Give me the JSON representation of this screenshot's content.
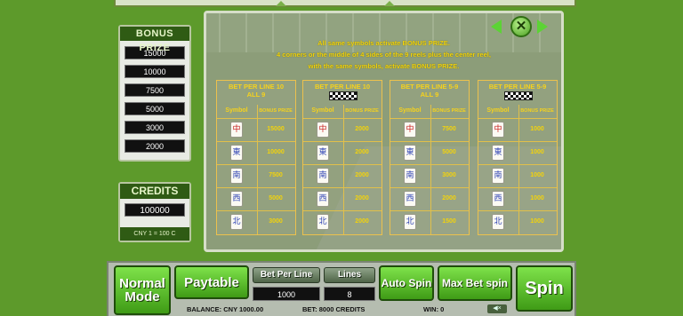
{
  "bonus": {
    "title": "BONUS PRIZE",
    "values": [
      "15000",
      "10000",
      "7500",
      "5000",
      "3000",
      "2000"
    ]
  },
  "credits": {
    "title": "CREDITS",
    "value": "100000",
    "rate": "CNY 1 = 100 C"
  },
  "paytable": {
    "info": [
      "All same symbols activate BONUS PRIZE.",
      "4 corners or the middle of 4 sides of the 9 reels plus the center reel,",
      "with the same symbols, activate BONUS PRIZE."
    ],
    "close_label": "✕",
    "tables": [
      {
        "title": "BET PER LINE 10",
        "subtitle": "ALL 9",
        "checker": false,
        "col_symbol": "Symbol",
        "col_prize": "BONUS PRIZE",
        "rows": [
          {
            "tile": "中",
            "color": "red",
            "value": "15000"
          },
          {
            "tile": "東",
            "color": "blue",
            "value": "10000"
          },
          {
            "tile": "南",
            "color": "blue",
            "value": "7500"
          },
          {
            "tile": "西",
            "color": "blue",
            "value": "5000"
          },
          {
            "tile": "北",
            "color": "blue",
            "value": "3000"
          }
        ]
      },
      {
        "title": "BET PER LINE 10",
        "subtitle": "",
        "checker": true,
        "col_symbol": "Symbol",
        "col_prize": "BONUS PRIZE",
        "rows": [
          {
            "tile": "中",
            "color": "red",
            "value": "2000"
          },
          {
            "tile": "東",
            "color": "blue",
            "value": "2000"
          },
          {
            "tile": "南",
            "color": "blue",
            "value": "2000"
          },
          {
            "tile": "西",
            "color": "blue",
            "value": "2000"
          },
          {
            "tile": "北",
            "color": "blue",
            "value": "2000"
          }
        ]
      },
      {
        "title": "BET PER LINE 5-9",
        "subtitle": "ALL 9",
        "checker": false,
        "col_symbol": "Symbol",
        "col_prize": "BONUS PRIZE",
        "rows": [
          {
            "tile": "中",
            "color": "red",
            "value": "7500"
          },
          {
            "tile": "東",
            "color": "blue",
            "value": "5000"
          },
          {
            "tile": "南",
            "color": "blue",
            "value": "3000"
          },
          {
            "tile": "西",
            "color": "blue",
            "value": "2000"
          },
          {
            "tile": "北",
            "color": "blue",
            "value": "1500"
          }
        ]
      },
      {
        "title": "BET PER LINE 5-9",
        "subtitle": "",
        "checker": true,
        "col_symbol": "Symbol",
        "col_prize": "BONUS PRIZE",
        "rows": [
          {
            "tile": "中",
            "color": "red",
            "value": "1000"
          },
          {
            "tile": "東",
            "color": "blue",
            "value": "1000"
          },
          {
            "tile": "南",
            "color": "blue",
            "value": "1000"
          },
          {
            "tile": "西",
            "color": "blue",
            "value": "1000"
          },
          {
            "tile": "北",
            "color": "blue",
            "value": "1000"
          }
        ]
      }
    ]
  },
  "controls": {
    "normal_mode": "Normal Mode",
    "paytable": "Paytable",
    "bet_per_line_label": "Bet Per Line",
    "bet_per_line_value": "1000",
    "lines_label": "Lines",
    "lines_value": "8",
    "auto_spin": "Auto Spin",
    "max_bet_spin": "Max Bet spin",
    "spin": "Spin"
  },
  "status": {
    "balance": "BALANCE: CNY 1000.00",
    "bet": "BET: 8000 CREDITS",
    "win": "WIN: 0"
  },
  "colors": {
    "background": "#5d9a2b",
    "accent_green": "#5cd335",
    "prize_yellow": "#f3d30c"
  }
}
